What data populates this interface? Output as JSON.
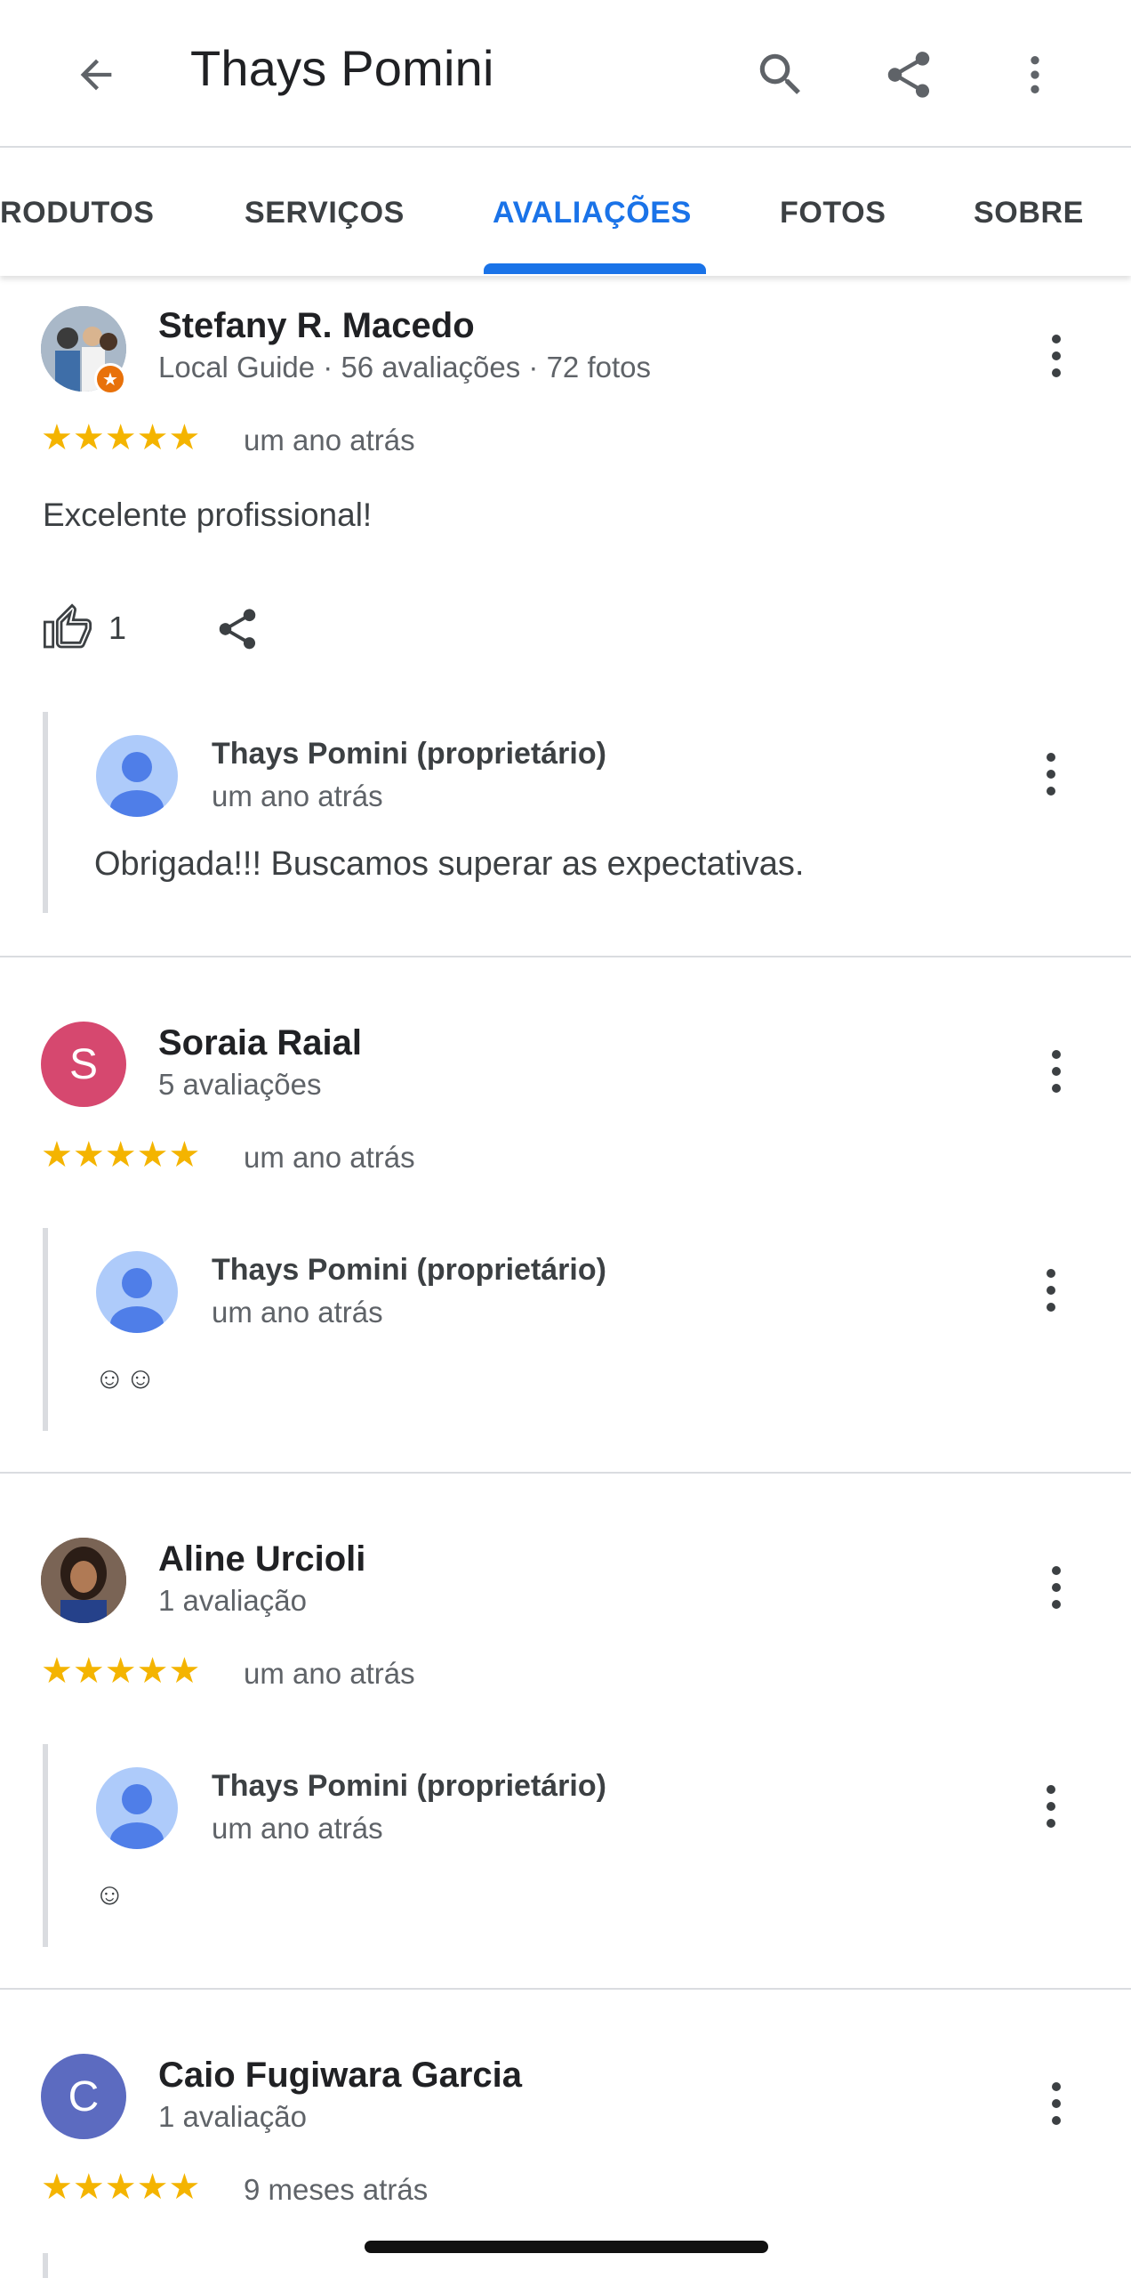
{
  "header": {
    "title": "Thays Pomini",
    "back_icon": "arrow-back-icon",
    "search_icon": "search-icon",
    "share_icon": "share-icon",
    "more_icon": "more-vert-icon"
  },
  "tabs": [
    {
      "label": "RODUTOS"
    },
    {
      "label": "SERVIÇOS"
    },
    {
      "label": "AVALIAÇÕES",
      "active": true
    },
    {
      "label": "FOTOS"
    },
    {
      "label": "SOBRE"
    }
  ],
  "colors": {
    "accent": "#1a73e8",
    "star": "#f4b400",
    "avatar_s": "#d6486f",
    "avatar_c": "#5c6bc0",
    "owner_avatar": "#aecbfa"
  },
  "reviews": [
    {
      "name": "Stefany R. Macedo",
      "meta": "Local Guide · 56 avaliações · 72 fotos",
      "stars": "★★★★★",
      "rating": 5,
      "time": "um ano atrás",
      "text": "Excelente profissional!",
      "likes": "1",
      "reply": {
        "name": "Thays Pomini (proprietário)",
        "time": "um ano atrás",
        "text": "Obrigada!!! Buscamos superar as expectativas."
      }
    },
    {
      "name": "Soraia Raial",
      "initial": "S",
      "meta": "5 avaliações",
      "stars": "★★★★★",
      "rating": 5,
      "time": "um ano atrás",
      "reply": {
        "name": "Thays Pomini (proprietário)",
        "time": "um ano atrás",
        "text": "☺☺"
      }
    },
    {
      "name": "Aline Urcioli",
      "meta": "1 avaliação",
      "stars": "★★★★★",
      "rating": 5,
      "time": "um ano atrás",
      "reply": {
        "name": "Thays Pomini (proprietário)",
        "time": "um ano atrás",
        "text": "☺"
      }
    },
    {
      "name": "Caio Fugiwara Garcia",
      "initial": "C",
      "meta": "1 avaliação",
      "stars": "★★★★★",
      "rating": 5,
      "time": "9 meses atrás"
    }
  ]
}
